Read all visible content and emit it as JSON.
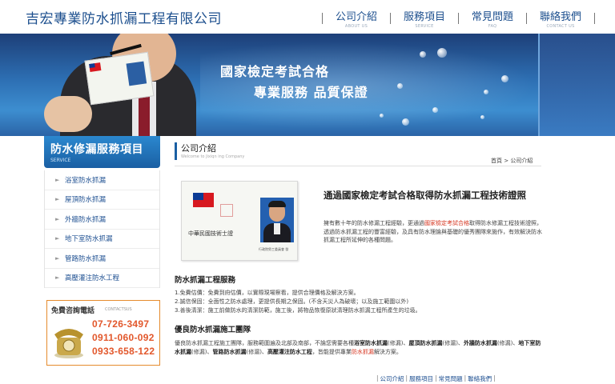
{
  "header": {
    "logo": "吉宏專業防水抓漏工程有限公司",
    "nav": [
      {
        "label": "公司介紹",
        "sub": "ABOUT US"
      },
      {
        "label": "服務項目",
        "sub": "SERVICE"
      },
      {
        "label": "常見問題",
        "sub": "FAQ"
      },
      {
        "label": "聯絡我們",
        "sub": "CONTACT US"
      }
    ]
  },
  "banner": {
    "title": "國家檢定考試合格",
    "subtitle": "專業服務  品質保證"
  },
  "sidebar": {
    "title": "防水修漏服務項目",
    "sub": "SERVICE",
    "items": [
      {
        "label": "浴室防水抓漏"
      },
      {
        "label": "屋頂防水抓漏"
      },
      {
        "label": "外牆防水抓漏"
      },
      {
        "label": "地下室防水抓漏"
      },
      {
        "label": "管路防水抓漏"
      },
      {
        "label": "高壓灌注防水工程"
      }
    ]
  },
  "contact": {
    "title": "免費咨詢電話",
    "sub": "CONTACTSUS",
    "phones": [
      "07-726-3497",
      "0911-060-092",
      "0933-658-122"
    ]
  },
  "main": {
    "title": "公司介紹",
    "subtitle": "Welcome to Jixiqn ing Company",
    "breadcrumb": "首頁 > 公司介紹",
    "license_text": "中華民國技術士證",
    "license_caption": "行政院勞工委員會 發",
    "headline": "通過國家檢定考試合格取得防水抓漏工程技術證照",
    "intro_a": "擁有數十年的防水修漏工程經驗，更通過",
    "intro_highlight": "國家檢定考試合格",
    "intro_b": "取得防水修漏工程技術證照，透過防水抓漏工程的豐富經驗，及具有防水理論與基礎的優秀團隊來施作，有效解決防水抓漏工程所延伸的各種問題。",
    "section1_title": "防水抓漏工程服務",
    "section1_items": [
      "1.免費估價：免費到府估價，以實際現場察看，提供合理價格及解決方案。",
      "2.誠信保固：全面性之防水處理，更提供長期之保固。(不含天災人為破壞；以及施工範圍以外)",
      "3.善後清潔：施工前做防水的清潔防範，施工後，將物品恢復原狀清理防水抓漏工程所產生的垃圾。"
    ],
    "section2_title": "優良防水抓漏施工團隊",
    "team_a": "優良防水抓漏工程施工團隊，服務範圍遍及北部及南部，不論您需要各種",
    "team_b1": "浴室防水抓漏",
    "team_b1n": "(修漏)、",
    "team_b2": "屋頂防水抓漏",
    "team_b2n": "(修漏)、",
    "team_b3": "外牆防水抓漏",
    "team_b3n": "(修漏)、",
    "team_b4": "地下室防水抓漏",
    "team_b4n": "(修漏)、",
    "team_b5": "管路防水抓漏",
    "team_b5n": "(修漏)、",
    "team_b6": "高壓灌注防水工程",
    "team_c": "，皆能提供專業",
    "team_red": "防水抓漏",
    "team_d": "解決方案。"
  },
  "footer": {
    "links": [
      "公司介紹",
      "服務項目",
      "常見問題",
      "聯絡我們"
    ]
  },
  "colors": {
    "brand_blue": "#1c4f8e",
    "accent_orange": "#e58b2d",
    "phone_red": "#e2572b",
    "highlight_red": "#d6341f"
  }
}
